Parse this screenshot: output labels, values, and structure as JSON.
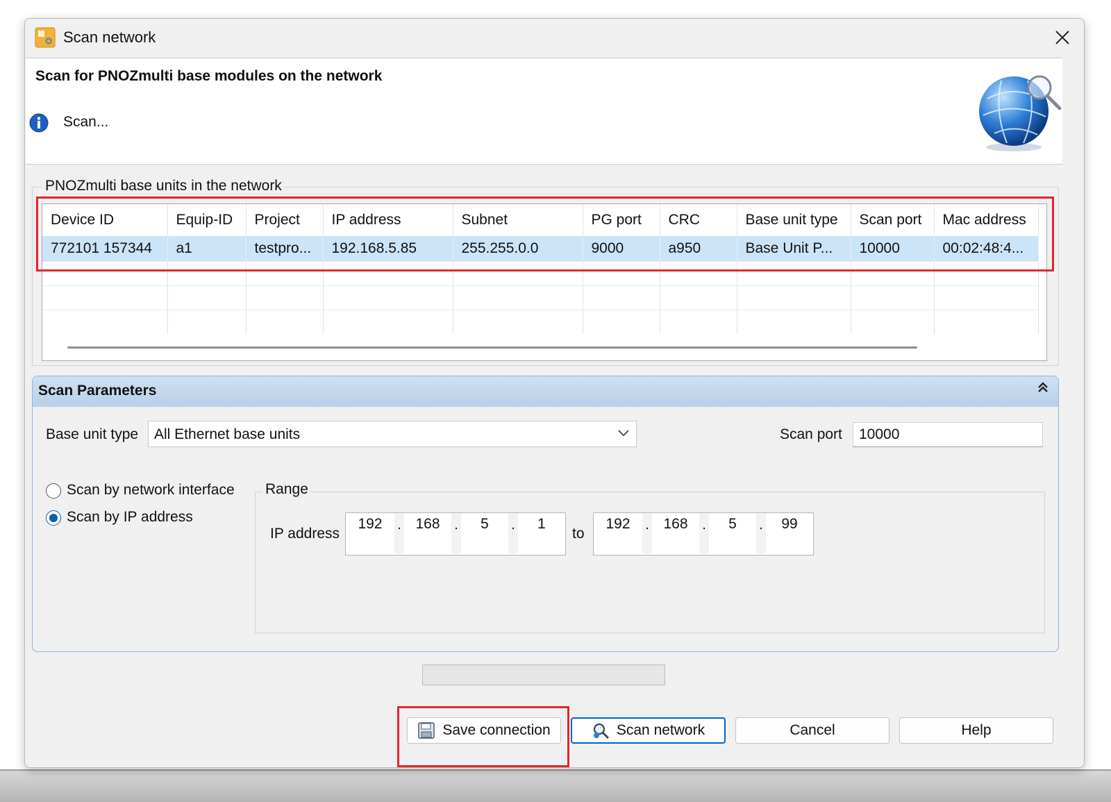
{
  "window": {
    "title": "Scan network",
    "header_title": "Scan for PNOZmulti base modules on the network",
    "status": "Scan..."
  },
  "units_group": {
    "label": "PNOZmulti base units in the network",
    "columns": [
      "Device ID",
      "Equip-ID",
      "Project",
      "IP address",
      "Subnet",
      "PG port",
      "CRC",
      "Base unit type",
      "Scan port",
      "Mac address"
    ],
    "rows": [
      [
        "772101 157344",
        "a1",
        "testpro...",
        "192.168.5.85",
        "255.255.0.0",
        "9000",
        "a950",
        "Base Unit P...",
        "10000",
        "00:02:48:4..."
      ]
    ]
  },
  "scan_parameters": {
    "title": "Scan Parameters",
    "base_unit_type_label": "Base unit type",
    "base_unit_type_value": "All Ethernet base units",
    "scan_port_label": "Scan port",
    "scan_port_value": "10000",
    "radio_network_interface": "Scan by network interface",
    "radio_ip_address": "Scan by IP address",
    "selected_radio": "ip_address",
    "range_label": "Range",
    "ip_address_label": "IP address",
    "to_label": "to",
    "ip_from": [
      "192",
      "168",
      "5",
      "1"
    ],
    "ip_to": [
      "192",
      "168",
      "5",
      "99"
    ]
  },
  "buttons": {
    "save_connection": "Save connection",
    "scan_network": "Scan network",
    "cancel": "Cancel",
    "help": "Help"
  },
  "colors": {
    "highlight_box": "#e3262b",
    "selected_row": "#cce4f7",
    "primary_button_border": "#0067c0"
  }
}
